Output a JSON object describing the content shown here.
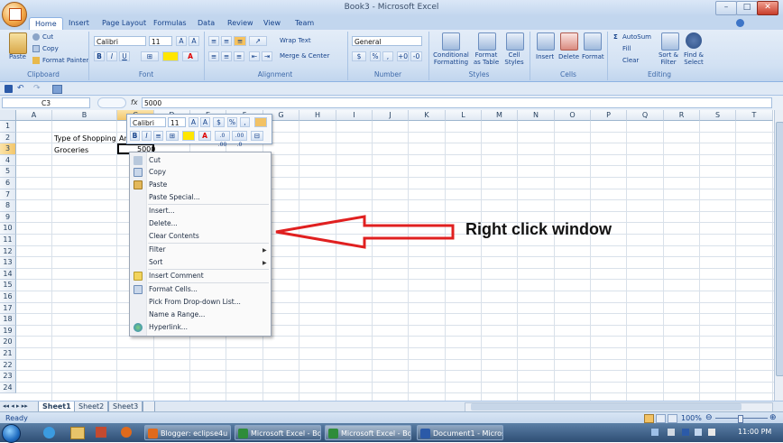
{
  "window": {
    "title": "Book3 - Microsoft Excel",
    "min": "–",
    "max": "□",
    "close": "✕"
  },
  "tabs": [
    "Home",
    "Insert",
    "Page Layout",
    "Formulas",
    "Data",
    "Review",
    "View",
    "Team"
  ],
  "ribbon": {
    "clipboard": {
      "paste": "Paste",
      "cut": "Cut",
      "copy": "Copy",
      "format_painter": "Format Painter",
      "label": "Clipboard"
    },
    "font": {
      "name": "Calibri",
      "size": "11",
      "label": "Font",
      "bold": "B",
      "italic": "I",
      "underline": "U"
    },
    "alignment": {
      "wrap": "Wrap Text",
      "merge": "Merge & Center",
      "label": "Alignment"
    },
    "number": {
      "format": "General",
      "label": "Number",
      "currency": "$",
      "percent": "%",
      "comma": ","
    },
    "styles": {
      "conditional": "Conditional Formatting",
      "format_table": "Format as Table",
      "cell_styles": "Cell Styles",
      "label": "Styles"
    },
    "cells": {
      "insert": "Insert",
      "delete": "Delete",
      "format": "Format",
      "label": "Cells"
    },
    "editing": {
      "autosum": "AutoSum",
      "fill": "Fill",
      "clear": "Clear",
      "sort": "Sort & Filter",
      "find": "Find & Select",
      "label": "Editing"
    }
  },
  "formula_bar": {
    "name_box": "C3",
    "fx": "fx",
    "value": "5000"
  },
  "columns": [
    "A",
    "B",
    "C",
    "D",
    "E",
    "F",
    "G",
    "H",
    "I",
    "J",
    "K",
    "L",
    "M",
    "N",
    "O",
    "P",
    "Q",
    "R",
    "S",
    "T"
  ],
  "rows": [
    "1",
    "2",
    "3",
    "4",
    "5",
    "6",
    "7",
    "8",
    "9",
    "10",
    "11",
    "12",
    "13",
    "14",
    "15",
    "16",
    "17",
    "18",
    "19",
    "20",
    "21",
    "22",
    "23",
    "24"
  ],
  "cells": {
    "b2": "Type of Shopping",
    "c2": "Am",
    "b3": "Groceries",
    "c3": "5000"
  },
  "mini_toolbar": {
    "font": "Calibri",
    "size": "11",
    "grow": "A",
    "shrink": "A",
    "currency": "$",
    "percent": "%",
    "comma": ",",
    "bold": "B",
    "italic": "I",
    "dec_inc": ".0 .00",
    "dec_dec": ".00 .0"
  },
  "context_menu": {
    "items": [
      "Cut",
      "Copy",
      "Paste",
      "Paste Special...",
      "Insert...",
      "Delete...",
      "Clear Contents",
      "Filter",
      "Sort",
      "Insert Comment",
      "Format Cells...",
      "Pick From Drop-down List...",
      "Name a Range...",
      "Hyperlink..."
    ]
  },
  "sheets": [
    "Sheet1",
    "Sheet2",
    "Sheet3"
  ],
  "status": {
    "ready": "Ready",
    "zoom": "100%"
  },
  "taskbar": {
    "items": [
      "Blogger: eclipse4u - ...",
      "Microsoft Excel - Bo...",
      "Microsoft Excel - Bo...",
      "Document1 - Micros..."
    ],
    "time": "11:00 PM"
  },
  "annotation": {
    "text": "Right click window"
  },
  "colors": {
    "accent": "#15428b",
    "annotation_arrow": "#e02020",
    "ribbon": "#d2e1f3"
  }
}
